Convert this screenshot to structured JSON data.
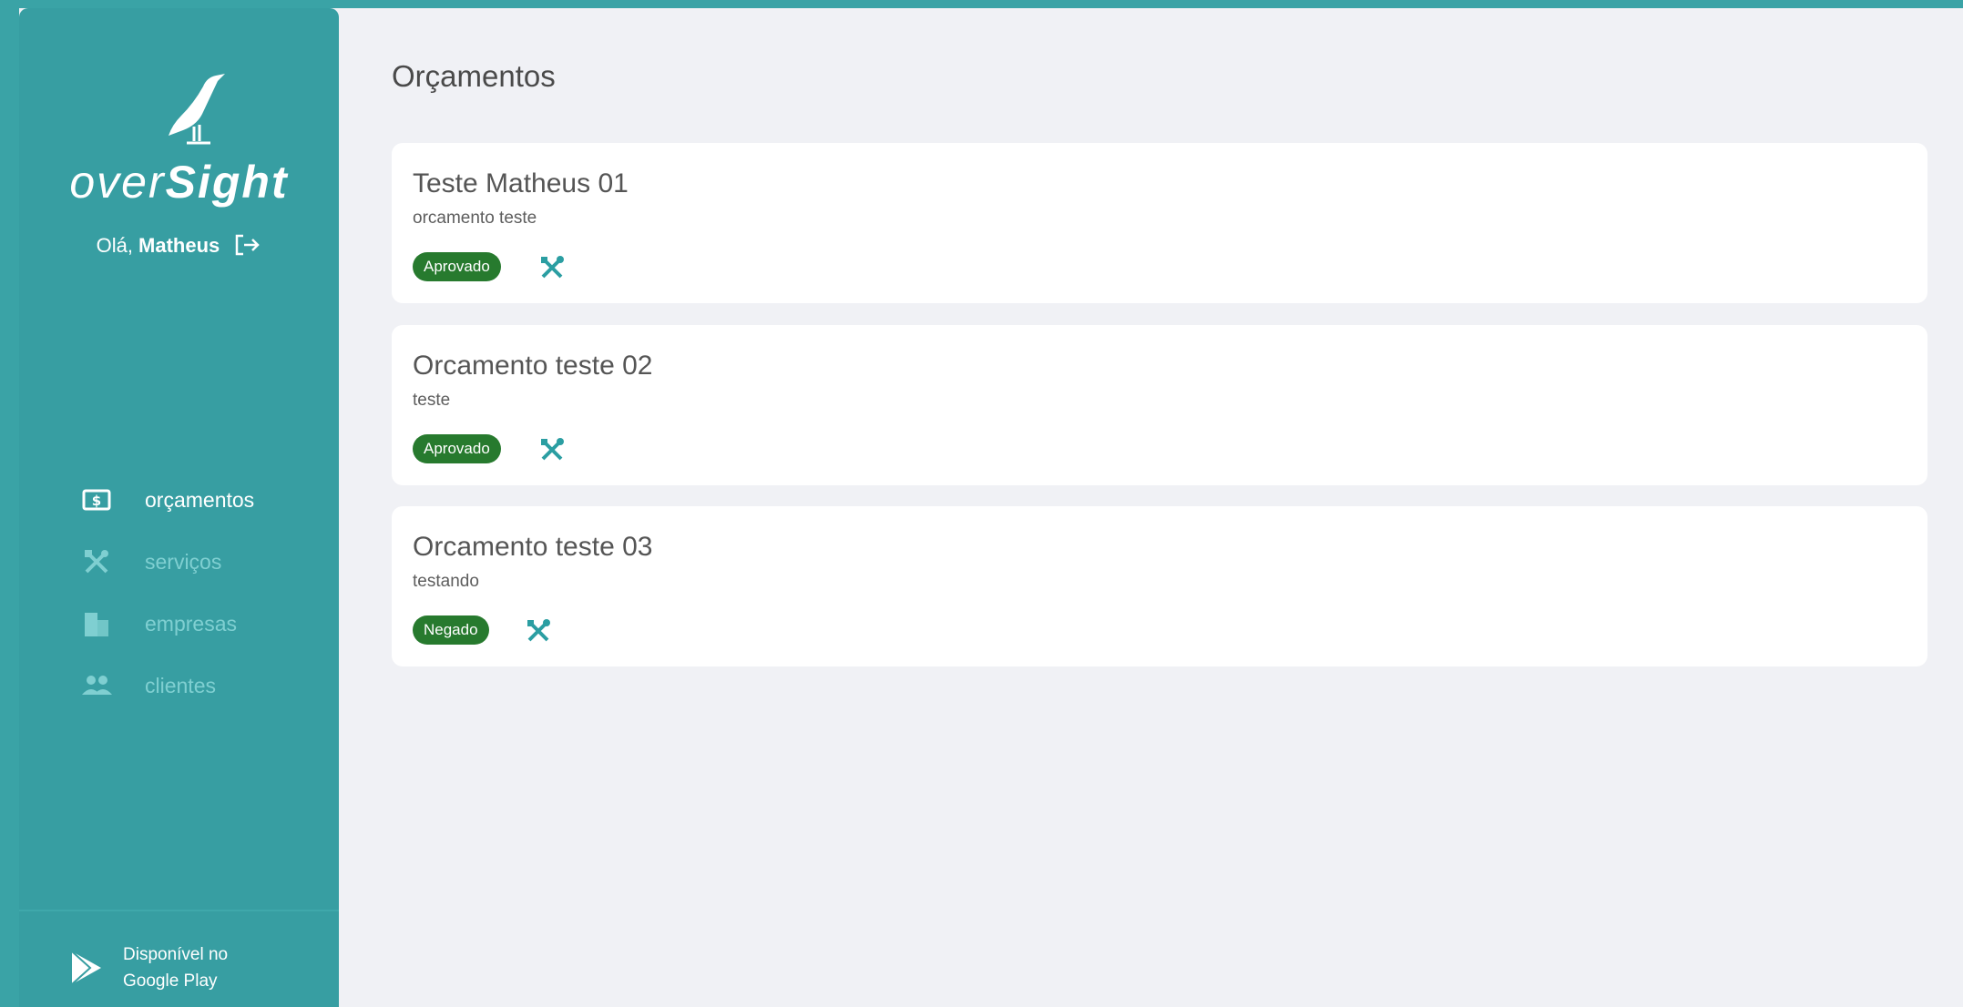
{
  "app": {
    "brand_light": "over",
    "brand_bold": "Sight",
    "greeting_prefix": "Olá, ",
    "user_name": "Matheus"
  },
  "nav": [
    {
      "label": "orçamentos",
      "icon": "money-icon",
      "active": true
    },
    {
      "label": "serviços",
      "icon": "tools-icon",
      "active": false
    },
    {
      "label": "empresas",
      "icon": "building-icon",
      "active": false
    },
    {
      "label": "clientes",
      "icon": "people-icon",
      "active": false
    }
  ],
  "store": {
    "line1": "Disponível no",
    "line2": "Google Play"
  },
  "page": {
    "title": "Orçamentos"
  },
  "budgets": [
    {
      "title": "Teste Matheus 01",
      "description": "orcamento teste",
      "status": "Aprovado"
    },
    {
      "title": "Orcamento teste 02",
      "description": "teste",
      "status": "Aprovado"
    },
    {
      "title": "Orcamento teste 03",
      "description": "testando",
      "status": "Negado"
    }
  ],
  "colors": {
    "sidebar": "#379ea2",
    "background": "#f0f1f5",
    "badge": "#277a2e",
    "accent": "#2b9ea2"
  }
}
